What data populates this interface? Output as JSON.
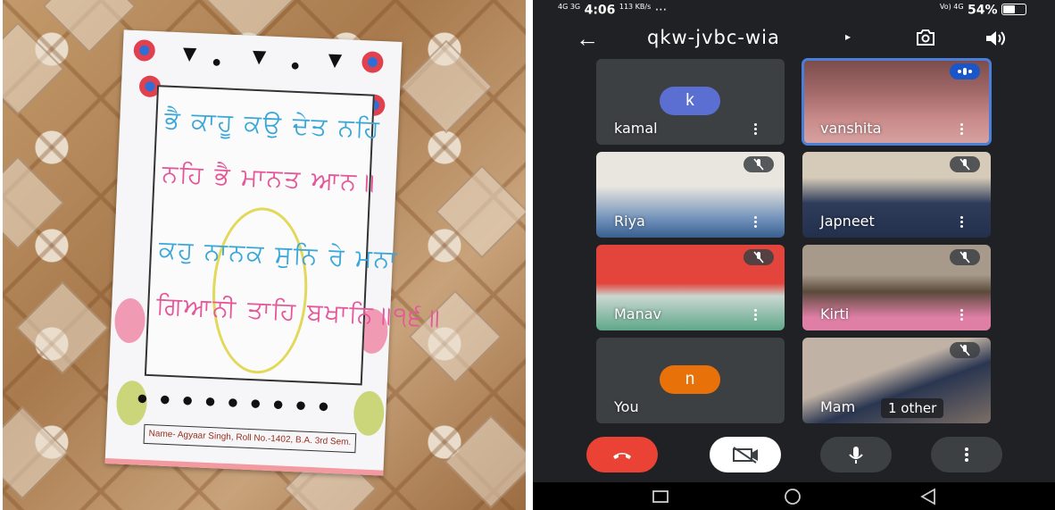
{
  "photo": {
    "poster_line1": "ਭੈ ਕਾਹੂ ਕਉ ਦੇਤ ਨਹਿ",
    "poster_line2": "ਨਹਿ ਭੈ ਮਾਨਤ ਆਨ॥",
    "poster_line3": "ਕਹੁ ਨਾਨਕ ਸੁਨਿ ਰੇ ਮਨਾ",
    "poster_line4": "ਗਿਆਨੀ ਤਾਹਿ ਬਖਾਨਿ॥੧੬॥",
    "name_strip": "Name- Agyaar Singh, Roll No.-1402, B.A. 3rd Sem."
  },
  "status_bar": {
    "signal_left": "4G 3G",
    "time": "4:06",
    "speed": "113 KB/s",
    "dots": "···",
    "network_right": "Vo) 4G",
    "battery": "54%"
  },
  "app_bar": {
    "meeting_code": "qkw-jvbc-wia",
    "caret": "▸"
  },
  "participants": [
    {
      "name": "kamal",
      "avatar_letter": "k",
      "avatar_color": "#5b6ed1",
      "video": false,
      "muted": false
    },
    {
      "name": "vanshita",
      "video": true,
      "speaking": true,
      "active": true
    },
    {
      "name": "Riya",
      "video": true,
      "muted": true
    },
    {
      "name": "Japneet",
      "video": true,
      "muted": true
    },
    {
      "name": "Manav",
      "video": true,
      "muted": true
    },
    {
      "name": "Kirti",
      "video": true,
      "muted": true
    },
    {
      "name": "You",
      "avatar_letter": "n",
      "avatar_color": "#e8710a",
      "video": false
    },
    {
      "name": "Mam",
      "video": true,
      "muted": true,
      "extra": "1 other"
    }
  ],
  "controls": {
    "end_call_color": "#ea4335",
    "camera_off_color": "#ffffff",
    "mic_color": "#3c4043"
  },
  "nav": {
    "back_shape": "square",
    "home_shape": "circle",
    "recents_shape": "triangle"
  }
}
